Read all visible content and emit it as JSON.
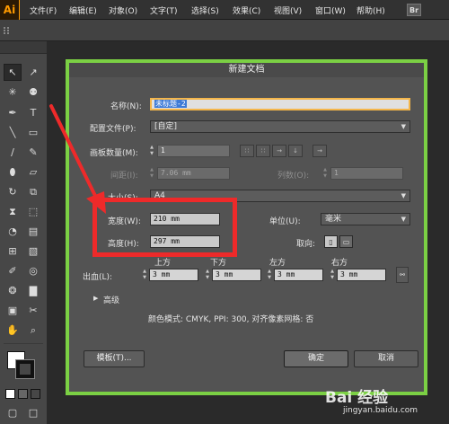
{
  "app": {
    "logo": "Ai",
    "bridge": "Br"
  },
  "menu": [
    {
      "label": "文件(F)"
    },
    {
      "label": "编辑(E)"
    },
    {
      "label": "对象(O)"
    },
    {
      "label": "文字(T)"
    },
    {
      "label": "选择(S)"
    },
    {
      "label": "效果(C)"
    },
    {
      "label": "视图(V)"
    },
    {
      "label": "窗口(W)"
    },
    {
      "label": "帮助(H)"
    }
  ],
  "dialog": {
    "title": "新建文档",
    "name_label": "名称(N):",
    "name_value": "未标题-2",
    "profile_label": "配置文件(P):",
    "profile_value": "[自定]",
    "artboards_label": "画板数量(M):",
    "artboards_value": "1",
    "spacing_label": "间距(I):",
    "spacing_value": "7.06 mm",
    "columns_label": "列数(O):",
    "columns_value": "1",
    "size_label": "大小(S):",
    "size_value": "A4",
    "width_label": "宽度(W):",
    "width_value": "210 mm",
    "units_label": "单位(U):",
    "units_value": "毫米",
    "height_label": "高度(H):",
    "height_value": "297 mm",
    "orientation_label": "取向:",
    "bleed_label": "出血(L):",
    "bleed_top_label": "上方",
    "bleed_bottom_label": "下方",
    "bleed_left_label": "左方",
    "bleed_right_label": "右方",
    "bleed_top": "3 mm",
    "bleed_bottom": "3 mm",
    "bleed_left": "3 mm",
    "bleed_right": "3 mm",
    "advanced_label": "高级",
    "info": "颜色模式: CMYK, PPI: 300, 对齐像素网格: 否",
    "templates_button": "模板(T)...",
    "ok_button": "确定",
    "cancel_button": "取消"
  },
  "watermark": {
    "brand": "Bai 经验",
    "url": "jingyan.baidu.com"
  },
  "colors": {
    "highlight_frame": "#7bd044",
    "annotation": "#ee2a2a",
    "accent": "#ff9a00"
  }
}
